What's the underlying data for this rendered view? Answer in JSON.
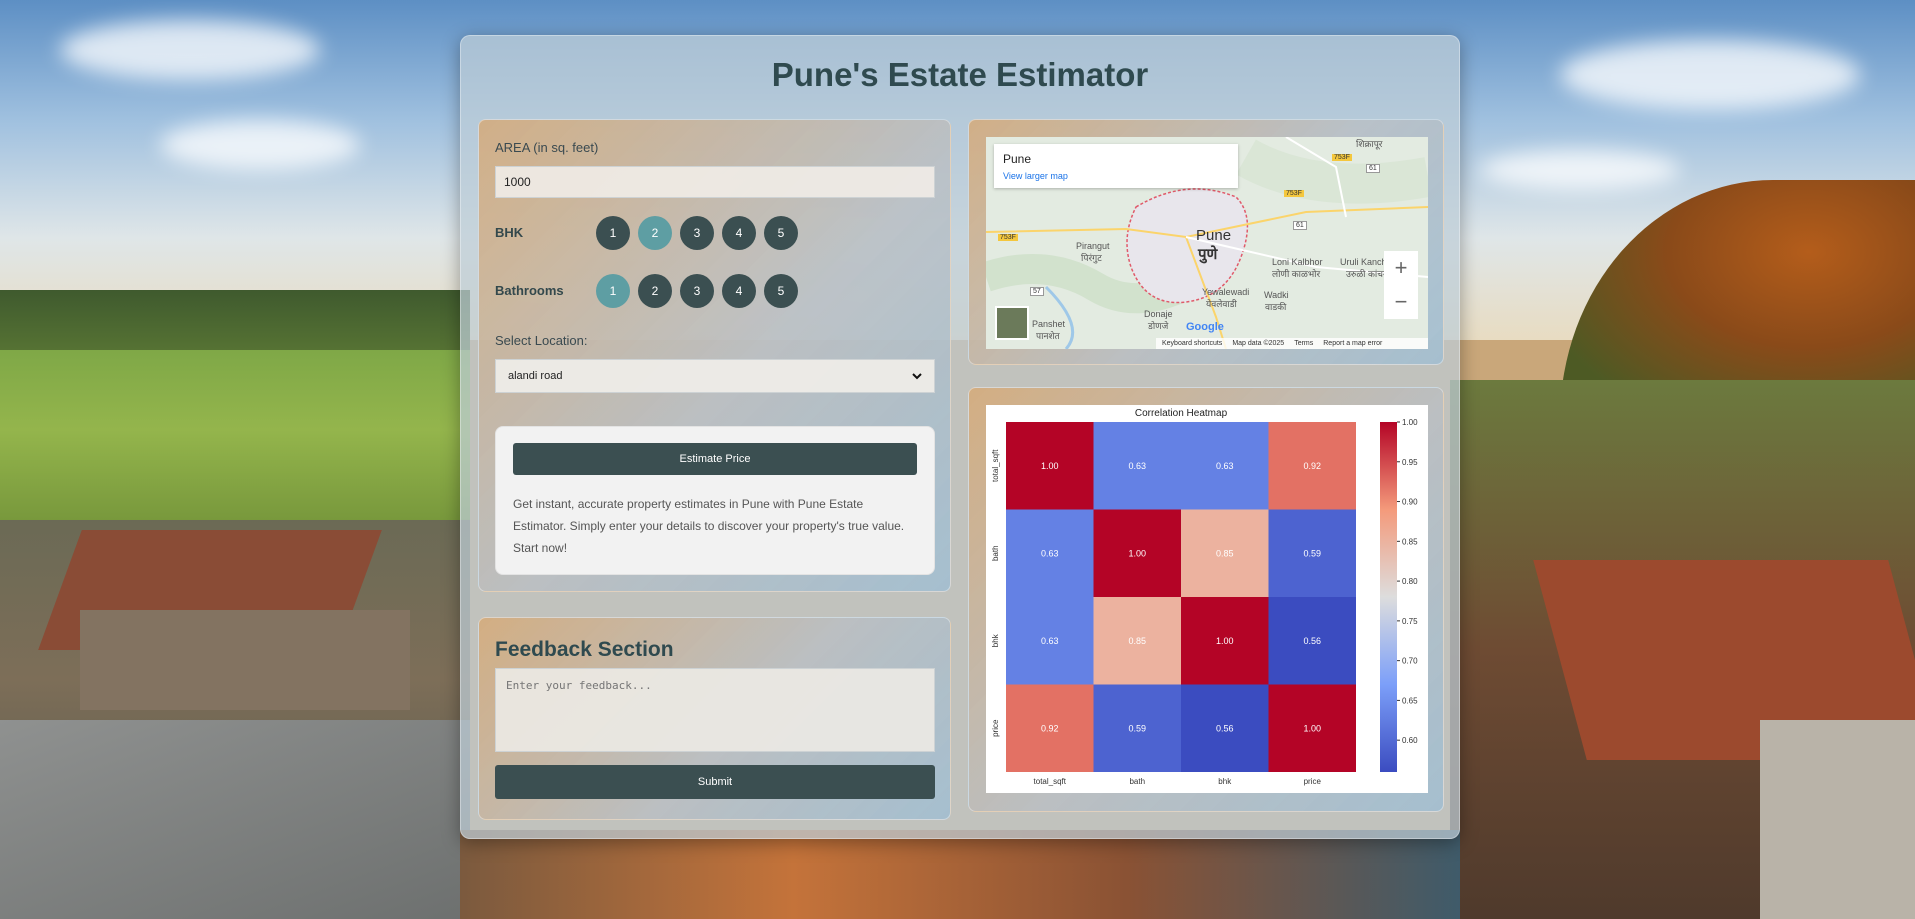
{
  "app": {
    "title": "Pune's Estate Estimator"
  },
  "form": {
    "area_label": "AREA (in sq. feet)",
    "area_value": "1000",
    "bhk_label": "BHK",
    "bhk_options": [
      "1",
      "2",
      "3",
      "4",
      "5"
    ],
    "bhk_selected": "2",
    "bath_label": "Bathrooms",
    "bath_options": [
      "1",
      "2",
      "3",
      "4",
      "5"
    ],
    "bath_selected": "1",
    "location_label": "Select Location:",
    "location_value": "alandi road",
    "estimate_button": "Estimate Price",
    "description": "Get instant, accurate property estimates in Pune with Pune Estate Estimator. Simply enter your details to discover your property's true value. Start now!"
  },
  "feedback": {
    "title": "Feedback Section",
    "placeholder": "Enter your feedback...",
    "submit_button": "Submit"
  },
  "map": {
    "place_name": "Pune",
    "view_larger": "View larger map",
    "city_label": "Pune",
    "city_label_local": "पुणे",
    "labels": [
      "Pirangut",
      "पिरंगुट",
      "Loni Kalbhor",
      "लोणी काळभोर",
      "Uruli Kanchan",
      "उरुळी कांचन",
      "Yewalewadi",
      "येवलेवाडी",
      "Wadki",
      "वाडकी",
      "Donaje",
      "डोणजे",
      "Panshet",
      "पानशेत",
      "शिक्रापूर"
    ],
    "road_badges": [
      "753F",
      "753F",
      "753F",
      "61",
      "61",
      "57"
    ],
    "zoom_in": "+",
    "zoom_out": "−",
    "google": "Google",
    "footer": [
      "Keyboard shortcuts",
      "Map data ©2025",
      "Terms",
      "Report a map error"
    ]
  },
  "colors": {
    "dark_teal": "#3b4f51",
    "active_teal": "#5e9ea3",
    "title": "#2f4a4f"
  },
  "chart_data": {
    "type": "heatmap",
    "title": "Correlation Heatmap",
    "x_labels": [
      "total_sqft",
      "bath",
      "bhk",
      "price"
    ],
    "y_labels": [
      "total_sqft",
      "bath",
      "bhk",
      "price"
    ],
    "values": [
      [
        1.0,
        0.63,
        0.63,
        0.92
      ],
      [
        0.63,
        1.0,
        0.85,
        0.59
      ],
      [
        0.63,
        0.85,
        1.0,
        0.56
      ],
      [
        0.92,
        0.59,
        0.56,
        1.0
      ]
    ],
    "colorbar_ticks": [
      "1.00",
      "0.95",
      "0.90",
      "0.85",
      "0.80",
      "0.75",
      "0.70",
      "0.65",
      "0.60"
    ],
    "colormap": "coolwarm",
    "vmin": 0.56,
    "vmax": 1.0
  }
}
